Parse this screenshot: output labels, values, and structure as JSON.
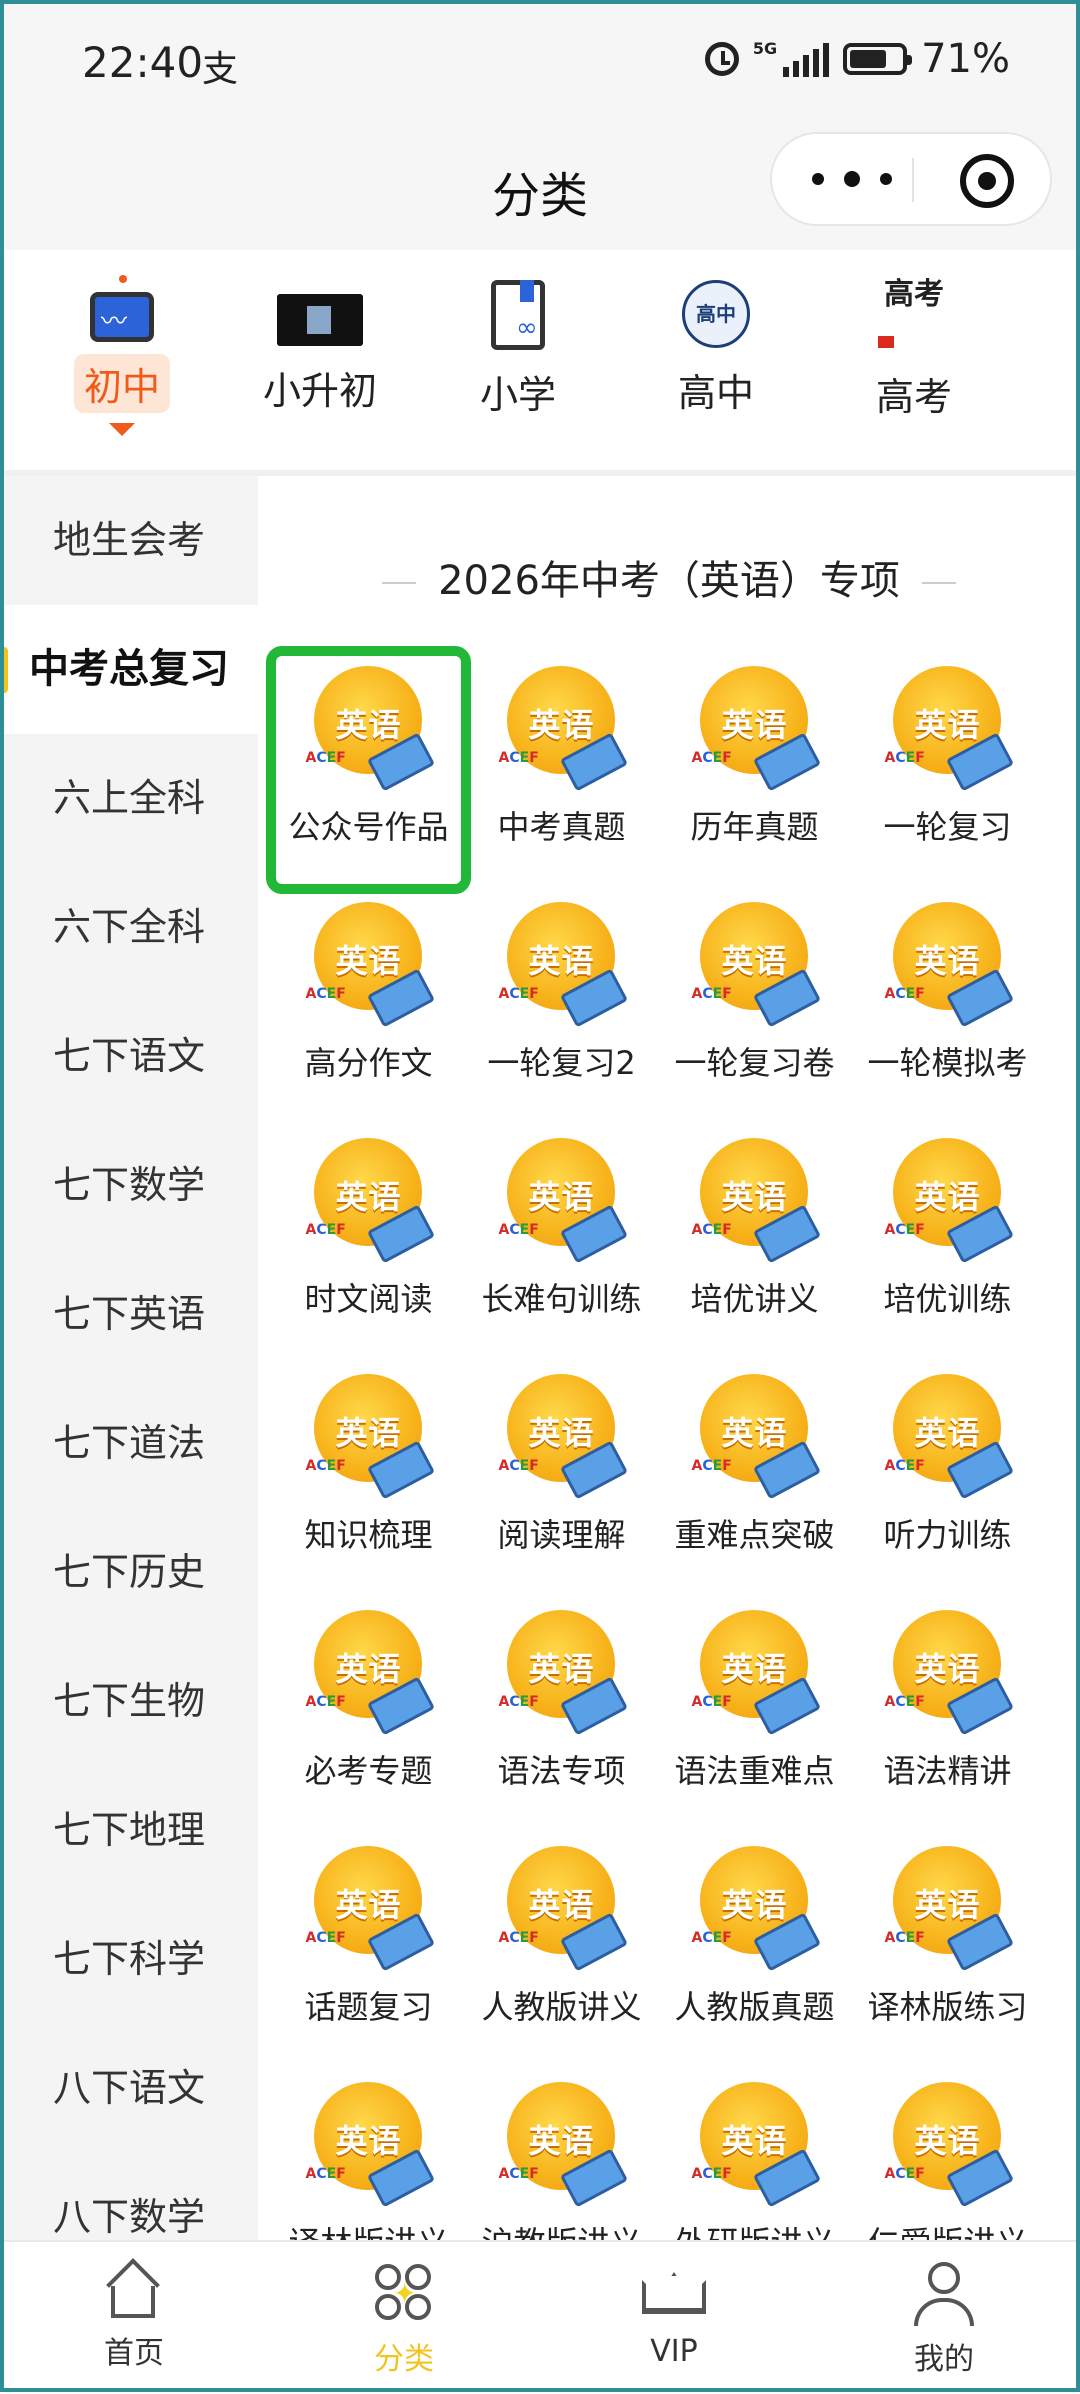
{
  "status_bar": {
    "time": "22:40",
    "app_glyph": "支",
    "network": "5G",
    "battery": "71%",
    "battery_level": 0.71
  },
  "nav": {
    "title": "分类"
  },
  "levels": [
    {
      "label": "初中",
      "icon": "blackboard-icon",
      "active": true
    },
    {
      "label": "小升初",
      "icon": "poster-icon",
      "active": false
    },
    {
      "label": "小学",
      "icon": "book-link-icon",
      "active": false
    },
    {
      "label": "高中",
      "icon": "high-school-badge-icon",
      "active": false
    },
    {
      "label": "高考",
      "icon": "gaokao-icon",
      "active": false
    }
  ],
  "high_icon_text": "高中",
  "gaokao_icon_text": "高考",
  "sidebar": {
    "items": [
      {
        "label": "地生会考",
        "active": false
      },
      {
        "label": "中考总复习",
        "active": true
      },
      {
        "label": "六上全科",
        "active": false
      },
      {
        "label": "六下全科",
        "active": false
      },
      {
        "label": "七下语文",
        "active": false
      },
      {
        "label": "七下数学",
        "active": false
      },
      {
        "label": "七下英语",
        "active": false
      },
      {
        "label": "七下道法",
        "active": false
      },
      {
        "label": "七下历史",
        "active": false
      },
      {
        "label": "七下生物",
        "active": false
      },
      {
        "label": "七下地理",
        "active": false
      },
      {
        "label": "七下科学",
        "active": false
      },
      {
        "label": "八下语文",
        "active": false
      },
      {
        "label": "八下数学",
        "active": false
      }
    ]
  },
  "content": {
    "section_title": "2026年中考（英语）专项",
    "icon_text": "英语",
    "items": [
      "公众号作品",
      "中考真题",
      "历年真题",
      "一轮复习",
      "高分作文",
      "一轮复习2",
      "一轮复习卷",
      "一轮模拟考",
      "时文阅读",
      "长难句训练",
      "培优讲义",
      "培优训练",
      "知识梳理",
      "阅读理解",
      "重难点突破",
      "听力训练",
      "必考专题",
      "语法专项",
      "语法重难点",
      "语法精讲",
      "话题复习",
      "人教版讲义",
      "人教版真题",
      "译林版练习",
      "译林版讲义",
      "沪教版讲义",
      "外研版讲义",
      "仁爱版讲义"
    ],
    "highlighted_index": 0
  },
  "tabbar": [
    {
      "label": "首页",
      "icon": "home-icon",
      "active": false
    },
    {
      "label": "分类",
      "icon": "category-icon",
      "active": true
    },
    {
      "label": "VIP",
      "icon": "crown-icon",
      "active": false
    },
    {
      "label": "我的",
      "icon": "profile-icon",
      "active": false
    }
  ],
  "colors": {
    "accent": "#f05a1a",
    "tab_active": "#f2c41f",
    "highlight_box": "#21b838",
    "icon_orange": "#f7b21a"
  }
}
